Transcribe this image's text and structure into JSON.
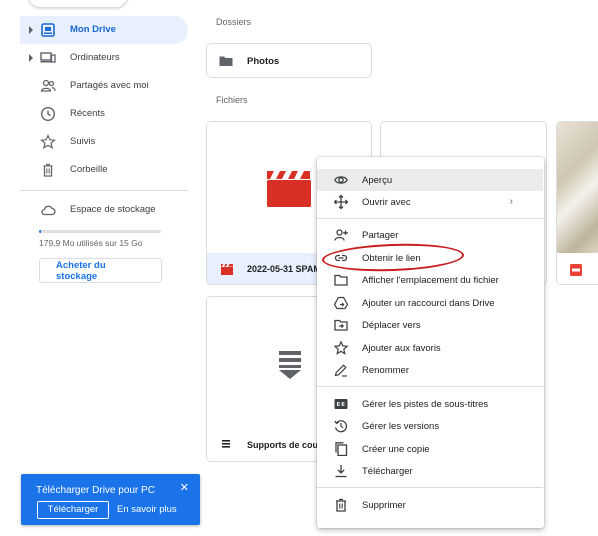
{
  "sidebar": {
    "items": [
      {
        "label": "Mon Drive",
        "icon": "drive-icon",
        "active": true
      },
      {
        "label": "Ordinateurs",
        "icon": "computers-icon"
      },
      {
        "label": "Partagés avec moi",
        "icon": "shared-icon"
      },
      {
        "label": "Récents",
        "icon": "clock-icon"
      },
      {
        "label": "Suivis",
        "icon": "star-icon"
      },
      {
        "label": "Corbeille",
        "icon": "trash-icon"
      }
    ],
    "storage": {
      "label": "Espace de stockage",
      "icon": "cloud-icon",
      "usage_text": "179,9 Mo utilisés sur 15 Go",
      "used_fraction": 0.012,
      "buy_label": "Acheter du stockage"
    }
  },
  "main": {
    "folders_label": "Dossiers",
    "folders": [
      {
        "name": "Photos",
        "icon": "folder-icon"
      }
    ],
    "files_label": "Fichiers",
    "files": [
      {
        "name": "2022-05-31 SPAM",
        "icon": "video-icon"
      },
      {
        "name": "Supports de cours",
        "icon": "docs-stack-icon"
      }
    ]
  },
  "download_banner": {
    "title": "Télécharger Drive pour PC",
    "download_label": "Télécharger",
    "more_label": "En savoir plus",
    "close_icon": "close-icon"
  },
  "context_menu": {
    "items": [
      {
        "label": "Aperçu",
        "icon": "eye-icon"
      },
      {
        "label": "Ouvrir avec",
        "icon": "move-arrows-icon",
        "chevron": "›"
      },
      {
        "label": "Partager",
        "icon": "add-person-icon"
      },
      {
        "label": "Obtenir le lien",
        "icon": "link-icon"
      },
      {
        "label": "Afficher l'emplacement du fichier",
        "icon": "folder-outline-icon"
      },
      {
        "label": "Ajouter un raccourci dans Drive",
        "icon": "drive-shortcut-icon"
      },
      {
        "label": "Déplacer vers",
        "icon": "move-to-folder-icon"
      },
      {
        "label": "Ajouter aux favoris",
        "icon": "star-outline-icon"
      },
      {
        "label": "Renommer",
        "icon": "pencil-icon"
      },
      {
        "label": "Gérer les pistes de sous-titres",
        "icon": "closed-caption-icon"
      },
      {
        "label": "Gérer les versions",
        "icon": "history-icon"
      },
      {
        "label": "Créer une copie",
        "icon": "copy-icon"
      },
      {
        "label": "Télécharger",
        "icon": "download-icon"
      },
      {
        "label": "Supprimer",
        "icon": "trash-icon"
      }
    ]
  },
  "colors": {
    "accent": "#1a73e8",
    "active_bg": "#e8f0fe",
    "annotation": "#c81e1e",
    "video_red": "#d93025"
  }
}
